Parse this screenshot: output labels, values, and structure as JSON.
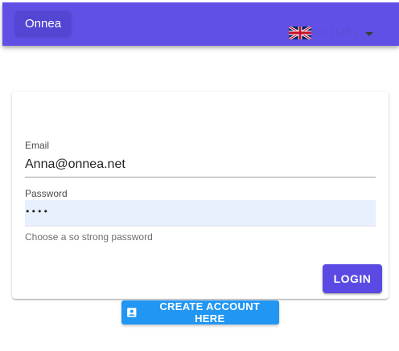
{
  "header": {
    "brand_label": "Onnea",
    "language": {
      "label": "en (US)",
      "flag_icon": "uk-flag-icon",
      "caret_icon": "caret-down-icon"
    }
  },
  "login_form": {
    "email": {
      "label": "Email",
      "value": "Anna@onnea.net"
    },
    "password": {
      "label": "Password",
      "masked_value": "••••",
      "hint": "Choose a so strong password"
    },
    "login_label": "LOGIN"
  },
  "create_account": {
    "label": "CREATE ACCOUNT HERE",
    "icon": "account-box-icon"
  },
  "colors": {
    "topbar": "#6050e6",
    "brand_button": "#5246d2",
    "login_button": "#5a4ae3",
    "create_button": "#2196f3",
    "autofill_bg": "#e8f0fe"
  }
}
